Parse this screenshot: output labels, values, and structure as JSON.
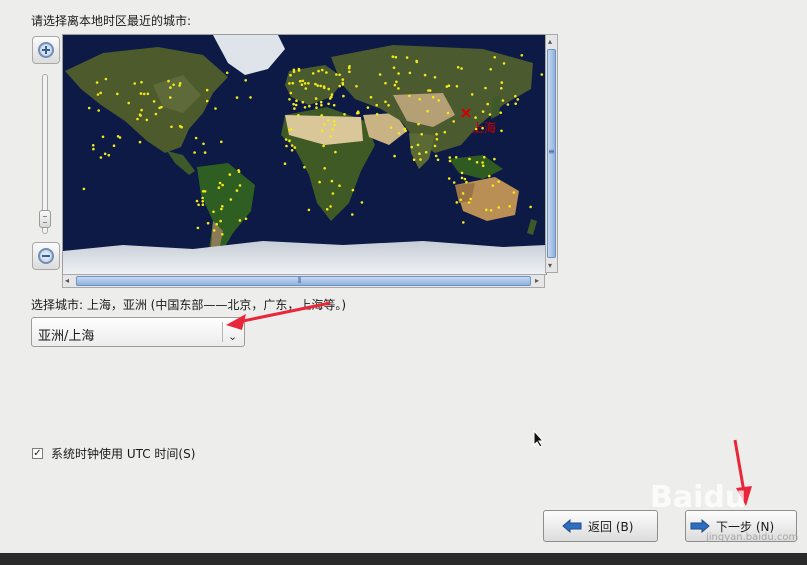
{
  "prompt": "请选择离本地时区最近的城市:",
  "map": {
    "selected_city_label": "上海",
    "accent_dot": "#f3ea1a",
    "marker": "#d10000"
  },
  "city_info": "选择城市: 上海，亚洲 (中国东部——北京，广东，上海等。)",
  "city_select": {
    "value": "亚洲/上海"
  },
  "utc": {
    "checked": true,
    "label": "系统时钟使用 UTC 时间(S)"
  },
  "buttons": {
    "back": "返回 (B)",
    "next": "下一步 (N)"
  },
  "watermark": {
    "text": "Baidu",
    "sub": "jingyan.baidu.com"
  },
  "colors": {
    "annotation_arrow": "#e8273a",
    "scroll_thumb": "#8fb1dd"
  }
}
